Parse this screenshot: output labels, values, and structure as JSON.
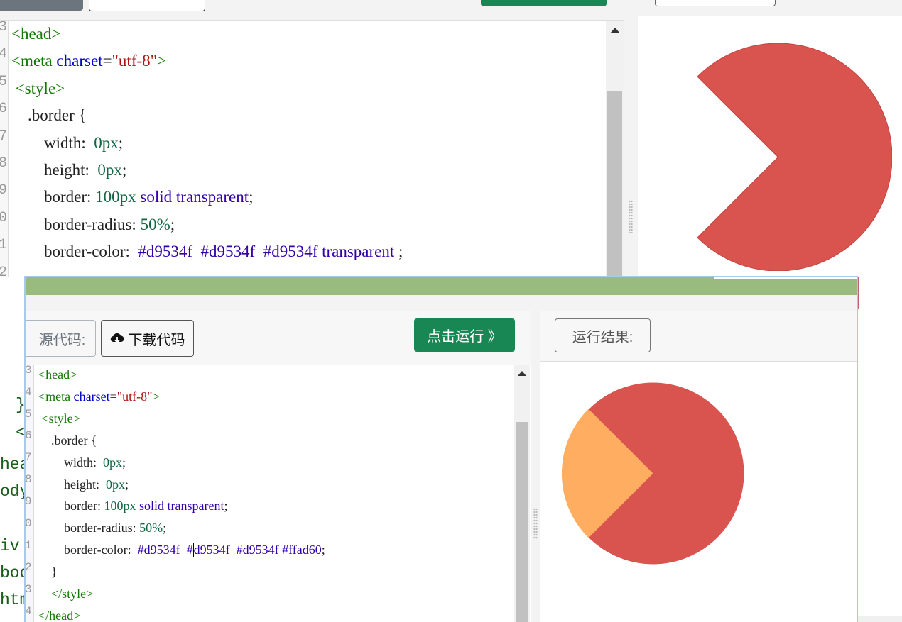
{
  "colors": {
    "accent": "#198754",
    "pie_main": "#d9534f",
    "pie_slice": "#ffad60",
    "titlebar": "#99bb7f"
  },
  "background_window": {
    "line_numbers": [
      "3",
      "4",
      "5",
      "6",
      "7",
      "8",
      "9",
      "0",
      "1",
      "2"
    ],
    "code_lines": {
      "l1": "<head>",
      "l2_tag": "<meta",
      "l2_attr": "charset",
      "l2_eq": "=",
      "l2_val": "\"utf-8\"",
      "l2_close": ">",
      "l3": "<style>",
      "l4": ".border {",
      "l5_prop": "width:",
      "l5_val": "0px",
      "l6_prop": "height:",
      "l6_val": "0px",
      "l7_prop": "border:",
      "l7_num": "100px",
      "l7_kw": "solid transparent",
      "l8_prop": "border-radius:",
      "l8_val": "50%",
      "l9_prop": "border-color:",
      "l9_vals": "#d9534f  #d9534f  #d9534f transparent",
      "semi": ";"
    }
  },
  "left_strip": [
    "}",
    "<",
    "hea",
    "ody",
    "iv",
    "bod",
    "htm"
  ],
  "front_window": {
    "toolbar": {
      "source_label": "源代码:",
      "download_label": "下载代码",
      "download_icon": "cloud-download-icon",
      "run_label": "点击运行 》"
    },
    "result_label": "运行结果:",
    "line_numbers": [
      "3",
      "4",
      "5",
      "6",
      "7",
      "8",
      "9",
      "0",
      "1",
      "2",
      "3",
      "4"
    ],
    "code_lines": {
      "l1": "<head>",
      "l2_tag": "<meta",
      "l2_attr": "charset",
      "l2_eq": "=",
      "l2_val": "\"utf-8\"",
      "l2_close": ">",
      "l3": "<style>",
      "l4": ".border {",
      "l5_prop": "width:",
      "l5_val": "0px",
      "l6_prop": "height:",
      "l6_val": "0px",
      "l7_prop": "border:",
      "l7_num": "100px",
      "l7_kw": "solid transparent",
      "l8_prop": "border-radius:",
      "l8_val": "50%",
      "l9_prop": "border-color:",
      "l9_v1": "#d9534f",
      "l9_v2a": "#",
      "l9_v2b": "d9534f",
      "l9_v3": "#d9534f",
      "l9_v4": "#ffad60",
      "l10": "}",
      "l11": "</style>",
      "l12": "</head>",
      "semi": ";"
    }
  }
}
